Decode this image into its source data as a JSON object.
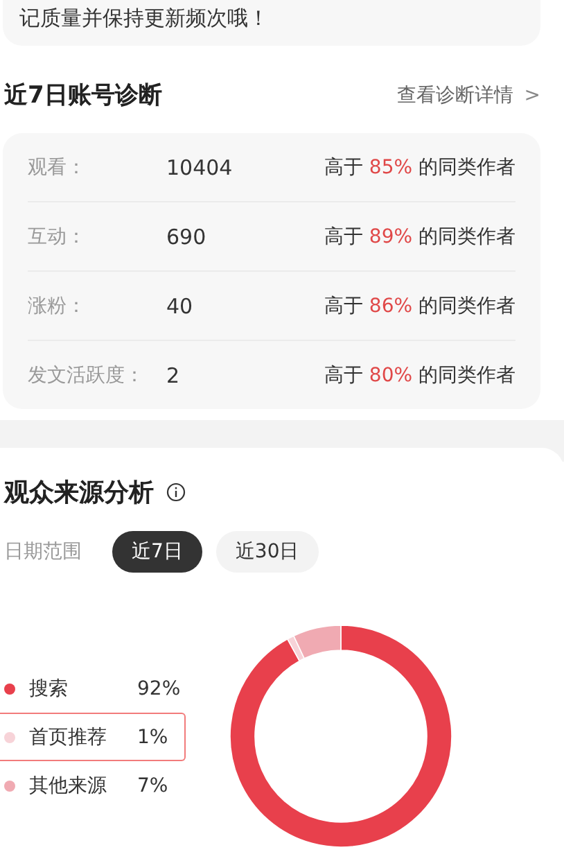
{
  "notice": {
    "text": "记质量并保持更新频次哦！"
  },
  "diagnosis": {
    "title": "近7日账号诊断",
    "link": "查看诊断详情",
    "link_icon": ">",
    "rows": [
      {
        "label": "观看：",
        "value": "10404",
        "prefix": "高于",
        "percent": "85%",
        "suffix": "的同类作者"
      },
      {
        "label": "互动：",
        "value": "690",
        "prefix": "高于",
        "percent": "89%",
        "suffix": "的同类作者"
      },
      {
        "label": "涨粉：",
        "value": "40",
        "prefix": "高于",
        "percent": "86%",
        "suffix": "的同类作者"
      },
      {
        "label": "发文活跃度：",
        "value": "2",
        "prefix": "高于",
        "percent": "80%",
        "suffix": "的同类作者"
      }
    ]
  },
  "audience": {
    "title": "观众来源分析",
    "date_label": "日期范围",
    "ranges": [
      {
        "label": "近7日",
        "selected": true
      },
      {
        "label": "近30日",
        "selected": false
      }
    ],
    "legend": [
      {
        "value": "92%",
        "highlighted": false
      },
      {
        "value": "1%",
        "highlighted": true
      },
      {
        "value": "7%",
        "highlighted": false
      }
    ],
    "chart_data": {
      "type": "donut",
      "categories": [
        "搜索",
        "首页推荐",
        "其他来源"
      ],
      "values": [
        92,
        1,
        7
      ],
      "colors": [
        "#e8404c",
        "#f7d3d8",
        "#f0aab2"
      ]
    }
  }
}
